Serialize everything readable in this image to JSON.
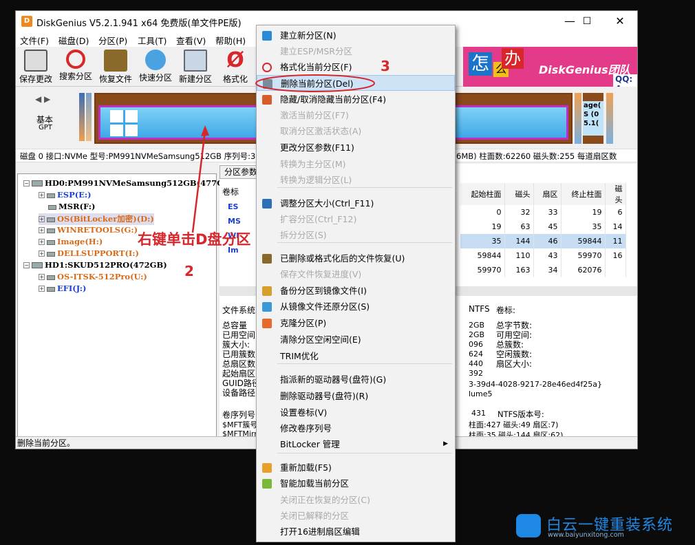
{
  "window": {
    "title": "DiskGenius V5.2.1.941 x64 免费版(单文件PE版)",
    "minimize": "—",
    "maximize": "☐",
    "close": "✕"
  },
  "menu": [
    "文件(F)",
    "磁盘(D)",
    "分区(P)",
    "工具(T)",
    "查看(V)",
    "帮助(H)"
  ],
  "toolbar": [
    "保存更改",
    "搜索分区",
    "恢复文件",
    "快速分区",
    "新建分区",
    "格式化"
  ],
  "banner": {
    "chars": [
      "怎",
      "么",
      "办"
    ],
    "brand": "DiskGenius团队",
    "qq": "QQ: 4"
  },
  "diskbar": {
    "basic": "基本",
    "gpt": "GPT",
    "right_labels": [
      "age(",
      "S (0",
      "5.1("
    ]
  },
  "diskinfo": {
    "left": "磁盘 0 接口:NVMe  型号:PM991NVMeSamsung512GB  序列号:3",
    "right": "6MB)  柱面数:62260  磁头数:255  每道扇区数"
  },
  "tree": {
    "disk0": "HD0:PM991NVMeSamsung512GB(477GB)",
    "d0parts": [
      "ESP(E:)",
      "MSR(F:)",
      "OS(BitLocker加密)(D:)",
      "WINRETOOLS(G:)",
      "Image(H:)",
      "DELLSUPPORT(I:)"
    ],
    "disk1": "HD1:SKUD512PRO(472GB)",
    "d1parts": [
      "OS-ITSK-512Pro(U:)",
      "EFI(J:)"
    ]
  },
  "right": {
    "tab": "分区参数",
    "vol_header": "卷标",
    "columns": [
      "起始柱面",
      "磁头",
      "扇区",
      "终止柱面",
      "磁头"
    ],
    "vols": [
      "ES",
      "MS",
      "",
      "WI",
      "Im"
    ],
    "rows": [
      [
        "0",
        "32",
        "33",
        "19",
        "6"
      ],
      [
        "19",
        "63",
        "45",
        "35",
        "14"
      ],
      [
        "35",
        "144",
        "46",
        "59844",
        "11"
      ],
      [
        "59844",
        "110",
        "43",
        "59970",
        "16"
      ],
      [
        "59970",
        "163",
        "34",
        "62076",
        ""
      ]
    ],
    "fs_label": "文件系统",
    "fs_value": "NTFS",
    "vol_label": "卷标:",
    "left_labels": [
      "总容量",
      "已用空间",
      "簇大小:",
      "已用簇数",
      "总扇区数",
      "起始扇区",
      "GUID路径",
      "设备路径"
    ],
    "mid_values": [
      "2GB",
      "2GB",
      "096",
      "624",
      "440",
      "392"
    ],
    "right_labels": [
      "总字节数:",
      "可用空间:",
      "总簇数:",
      "空闲簇数:",
      "扇区大小:"
    ],
    "guid": "3-39d4-4028-9217-28e46ed4f25a}",
    "device": "lume5",
    "serial_label": "卷序列号",
    "serial_value": "431",
    "ntfs_ver": "NTFS版本号:",
    "mft_label": "$MFT簇号",
    "mft_value": "柱面:427 磁头:49 扇区:7)",
    "mftmirr_label": "$MFTMirr",
    "mftmirr_value": "柱面:35 磁头:144 扇区:62)"
  },
  "status": "删除当前分区。",
  "context_menu": [
    {
      "label": "建立新分区(N)",
      "disabled": false,
      "icon": "new-partition-icon",
      "color": "#2a8bd8"
    },
    {
      "label": "建立ESP/MSR分区",
      "disabled": true,
      "icon": "",
      "color": ""
    },
    {
      "label": "格式化当前分区(F)",
      "disabled": false,
      "icon": "format-icon",
      "color": "#d8262b"
    },
    {
      "label": "删除当前分区(Del)",
      "disabled": false,
      "icon": "delete-icon",
      "color": "#7a8b99"
    },
    {
      "label": "隐藏/取消隐藏当前分区(F4)",
      "disabled": false,
      "icon": "hide-icon",
      "color": "#d85b2a"
    },
    {
      "label": "激活当前分区(F7)",
      "disabled": true,
      "icon": "",
      "color": ""
    },
    {
      "label": "取消分区激活状态(A)",
      "disabled": true,
      "icon": "",
      "color": ""
    },
    {
      "label": "更改分区参数(F11)",
      "disabled": false,
      "icon": "",
      "color": ""
    },
    {
      "label": "转换为主分区(M)",
      "disabled": true,
      "icon": "",
      "color": ""
    },
    {
      "label": "转换为逻辑分区(L)",
      "disabled": true,
      "icon": "",
      "color": ""
    },
    {
      "label": "调整分区大小(Ctrl_F11)",
      "disabled": false,
      "icon": "resize-icon",
      "color": "#2a6fb8"
    },
    {
      "label": "扩容分区(Ctrl_F12)",
      "disabled": true,
      "icon": "",
      "color": ""
    },
    {
      "label": "拆分分区(S)",
      "disabled": true,
      "icon": "",
      "color": ""
    },
    {
      "label": "已删除或格式化后的文件恢复(U)",
      "disabled": false,
      "icon": "recover-icon",
      "color": "#8a6a2a"
    },
    {
      "label": "保存文件恢复进度(V)",
      "disabled": true,
      "icon": "",
      "color": ""
    },
    {
      "label": "备份分区到镜像文件(I)",
      "disabled": false,
      "icon": "backup-icon",
      "color": "#d8a02a"
    },
    {
      "label": "从镜像文件还原分区(S)",
      "disabled": false,
      "icon": "restore-icon",
      "color": "#3a9ad8"
    },
    {
      "label": "克隆分区(P)",
      "disabled": false,
      "icon": "clone-icon",
      "color": "#e86a2a"
    },
    {
      "label": "清除分区空闲空间(E)",
      "disabled": false,
      "icon": "",
      "color": ""
    },
    {
      "label": "TRIM优化",
      "disabled": false,
      "icon": "",
      "color": ""
    },
    {
      "label": "指派新的驱动器号(盘符)(G)",
      "disabled": false,
      "icon": "",
      "color": ""
    },
    {
      "label": "删除驱动器号(盘符)(R)",
      "disabled": false,
      "icon": "",
      "color": ""
    },
    {
      "label": "设置卷标(V)",
      "disabled": false,
      "icon": "",
      "color": ""
    },
    {
      "label": "修改卷序列号",
      "disabled": false,
      "icon": "",
      "color": ""
    },
    {
      "label": "BitLocker 管理",
      "disabled": false,
      "icon": "",
      "color": ""
    },
    {
      "label": "重新加载(F5)",
      "disabled": false,
      "icon": "reload-icon",
      "color": "#e8a02a"
    },
    {
      "label": "智能加载当前分区",
      "disabled": false,
      "icon": "smart-load-icon",
      "color": "#7ab83a"
    },
    {
      "label": "关闭正在恢复的分区(C)",
      "disabled": true,
      "icon": "",
      "color": ""
    },
    {
      "label": "关闭已解释的分区",
      "disabled": true,
      "icon": "",
      "color": ""
    },
    {
      "label": "打开16进制扇区编辑",
      "disabled": false,
      "icon": "",
      "color": ""
    }
  ],
  "annotations": {
    "step3": "3",
    "step2": "2",
    "right_click": "右键单击D盘分区",
    "accent": "#d8262b"
  },
  "brand": {
    "name": "白云一键重装系统",
    "url": "www.baiyunxitong.com"
  }
}
